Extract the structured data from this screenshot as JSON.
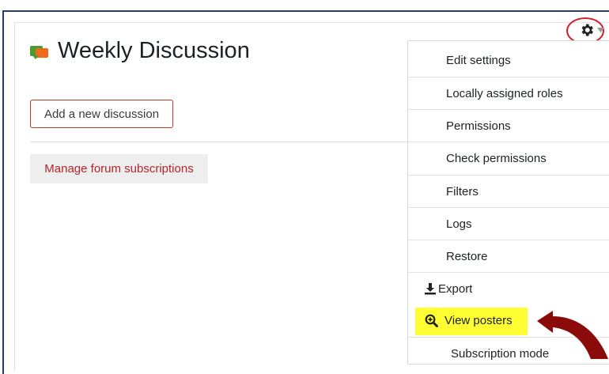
{
  "page": {
    "title": "Weekly Discussion",
    "add_discussion_label": "Add a new discussion",
    "manage_subscriptions_label": "Manage forum subscriptions"
  },
  "menu": {
    "items": [
      {
        "label": "Edit settings"
      },
      {
        "label": "Locally assigned roles"
      },
      {
        "label": "Permissions"
      },
      {
        "label": "Check permissions"
      },
      {
        "label": "Filters"
      },
      {
        "label": "Logs"
      },
      {
        "label": "Restore"
      },
      {
        "label": "Export",
        "icon": "download-icon"
      },
      {
        "label": "View posters",
        "icon": "zoom-in-icon",
        "highlighted": true
      },
      {
        "label": "Subscription mode"
      }
    ]
  },
  "icons": {
    "forum": "forum-icon",
    "gear": "gear-icon",
    "annotation": "curved-arrow-icon"
  },
  "colors": {
    "accent_red": "#c0392b",
    "link_red": "#b3242b",
    "highlight_yellow": "#ffff33",
    "annotation_arrow": "#8b0000",
    "frame_blue": "#1f3d7a"
  }
}
